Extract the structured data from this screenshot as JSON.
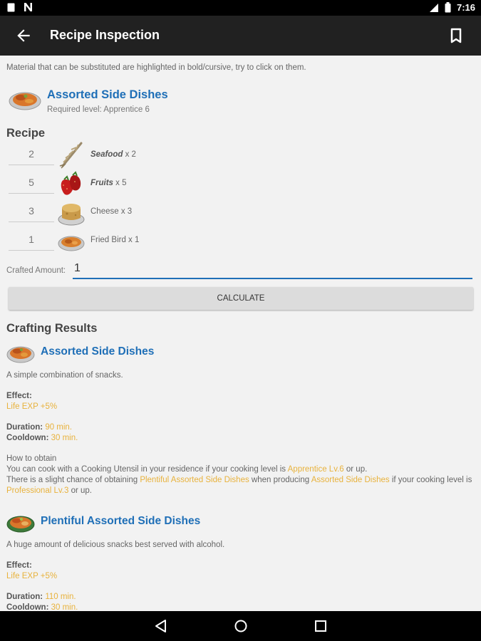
{
  "status": {
    "time": "7:16"
  },
  "app_bar": {
    "title": "Recipe Inspection"
  },
  "hint": "Material that can be substituted are highlighted in bold/cursive, try to click on them.",
  "item": {
    "name": "Assorted Side Dishes",
    "required_level": "Required level: Apprentice 6"
  },
  "recipe": {
    "title": "Recipe",
    "ingredients": [
      {
        "qty": "2",
        "name": "Seafood",
        "count": " x 2",
        "substitutable": true,
        "icon": "seafood-icon"
      },
      {
        "qty": "5",
        "name": "Fruits",
        "count": " x 5",
        "substitutable": true,
        "icon": "fruits-icon"
      },
      {
        "qty": "3",
        "name": "Cheese",
        "count": " x 3",
        "substitutable": false,
        "icon": "cheese-icon"
      },
      {
        "qty": "1",
        "name": "Fried Bird",
        "count": " x 1",
        "substitutable": false,
        "icon": "fried-bird-icon"
      }
    ]
  },
  "crafted": {
    "label": "Crafted Amount:",
    "value": "1"
  },
  "calculate_label": "CALCULATE",
  "results": {
    "title": "Crafting Results",
    "items": [
      {
        "name": "Assorted Side Dishes",
        "description": "A simple combination of snacks.",
        "effect_label": "Effect:",
        "effect_value": "Life EXP +5%",
        "duration_label": "Duration:",
        "duration_value": "90 min.",
        "cooldown_label": "Cooldown:",
        "cooldown_value": "30 min.",
        "how_title": "How to obtain",
        "how_1a": "You can cook with a Cooking Utensil in your residence if your cooking level is ",
        "how_1b": "Apprentice Lv.6",
        "how_1c": " or up.",
        "how_2a": "There is a slight chance of obtaining ",
        "how_2b": "Plentiful Assorted Side Dishes",
        "how_2c": " when producing ",
        "how_2d": "Assorted Side Dishes",
        "how_2e": " if your cooking level is ",
        "how_2f": "Professional Lv.3",
        "how_2g": " or up."
      },
      {
        "name": "Plentiful Assorted Side Dishes",
        "description": "A huge amount of delicious snacks best served with alcohol.",
        "effect_label": "Effect:",
        "effect_value": "Life EXP +5%",
        "duration_label": "Duration:",
        "duration_value": "110 min.",
        "cooldown_label": "Cooldown:",
        "cooldown_value": "30 min."
      }
    ]
  },
  "colors": {
    "accent": "#1f6fb7",
    "highlight": "#e8b23c",
    "app_bar": "#212121"
  }
}
